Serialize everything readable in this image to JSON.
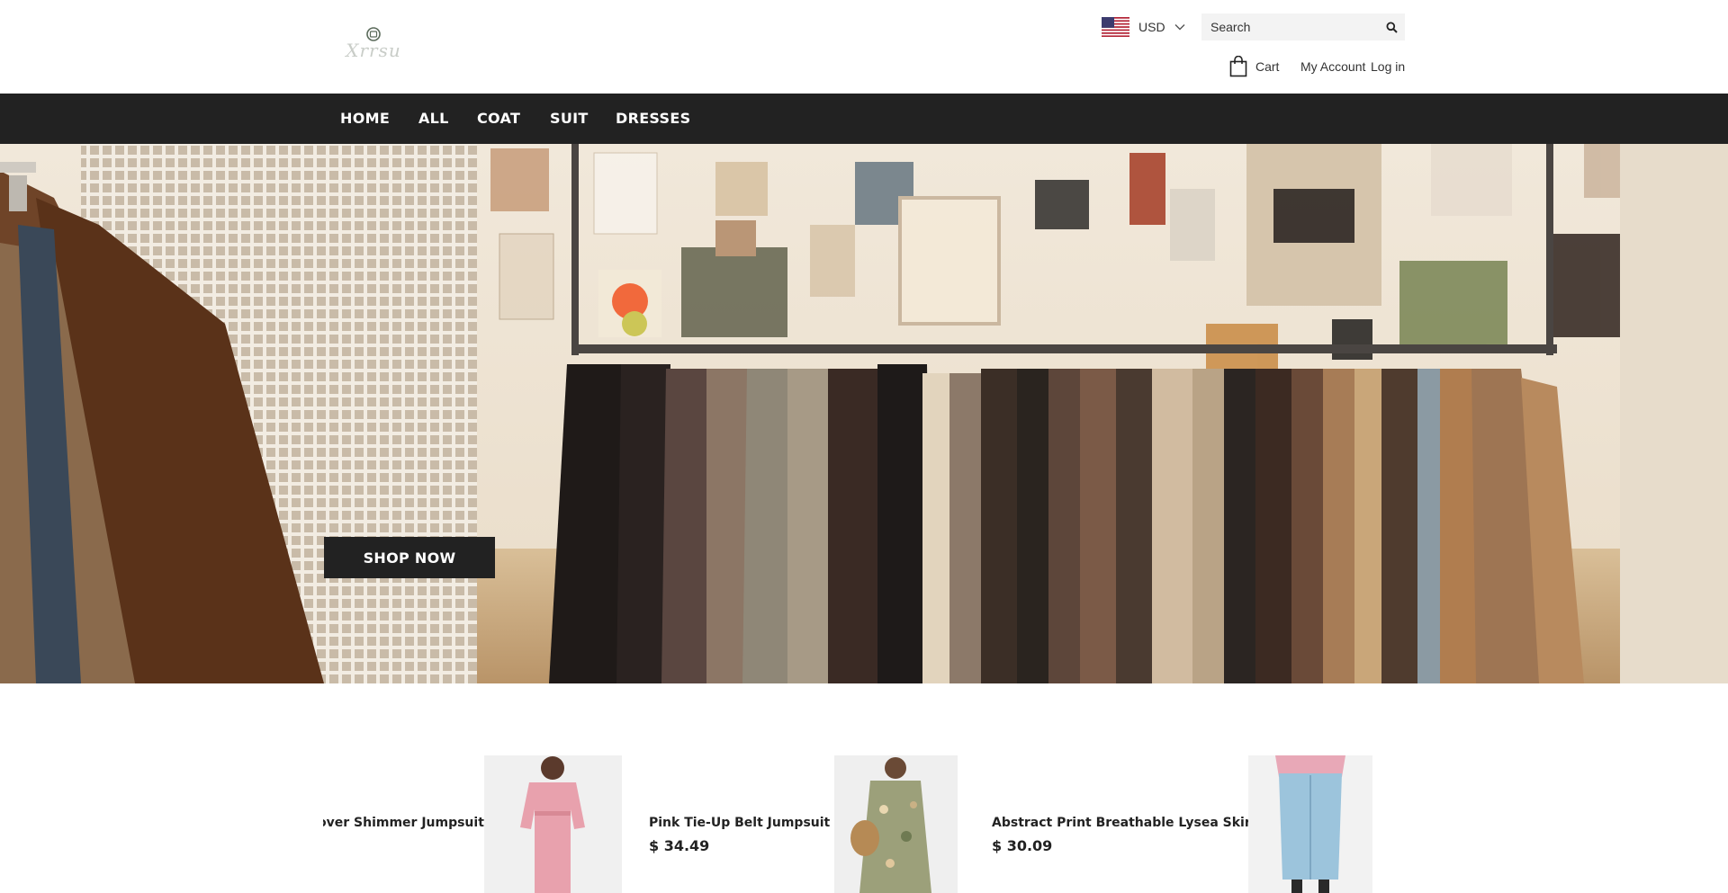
{
  "header": {
    "logo_text": "Xrrsu",
    "currency": {
      "code": "USD",
      "flag_icon": "us-flag-icon"
    },
    "search": {
      "placeholder": "Search",
      "icon": "search-icon"
    },
    "cart_label": "Cart",
    "account_label": "My Account",
    "login_label": "Log in"
  },
  "nav": {
    "items": [
      {
        "label": "HOME"
      },
      {
        "label": "ALL"
      },
      {
        "label": "COAT"
      },
      {
        "label": "SUIT"
      },
      {
        "label": "DRESSES"
      }
    ]
  },
  "hero": {
    "cta_label": "SHOP NOW"
  },
  "products": [
    {
      "name": "Silver Shimmer Jumpsuit",
      "visible_name": "over Shimmer Jumpsuit",
      "price": ""
    },
    {
      "name": "Pink Tie-Up Belt Jumpsuit",
      "price": "$ 34.49"
    },
    {
      "name": "Abstract Print Breathable Lysea Skirt",
      "price": "$ 30.09"
    }
  ],
  "colors": {
    "nav_bg": "#222222",
    "button_bg": "#222222",
    "text": "#222222",
    "search_bg": "#f3f3f3"
  }
}
